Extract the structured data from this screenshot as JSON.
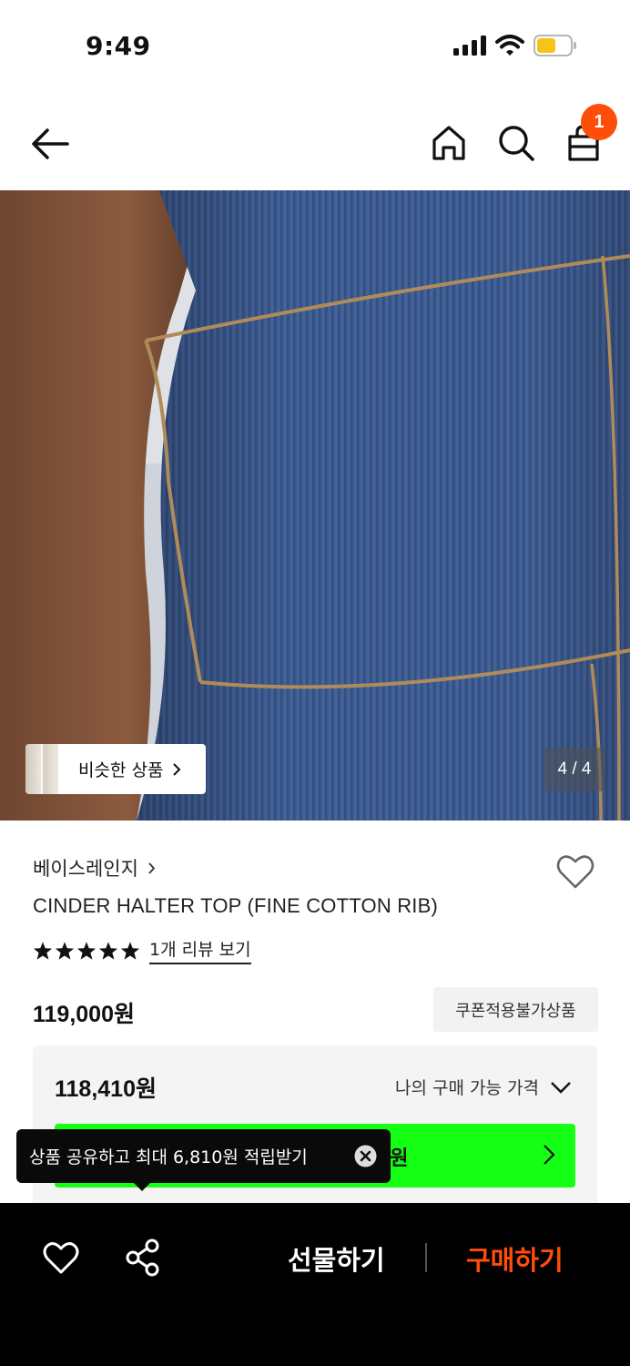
{
  "status_bar": {
    "time": "9:49",
    "icons": [
      "signal-icon",
      "wifi-icon",
      "battery-icon"
    ],
    "battery_color": "#f7c31b"
  },
  "nav": {
    "icons": [
      "back-arrow-icon",
      "home-icon",
      "search-icon",
      "bag-icon"
    ],
    "cart_count": "1",
    "badge_color": "#ff4d0a"
  },
  "gallery": {
    "similar_label": "비슷한 상품",
    "counter": "4 / 4"
  },
  "product": {
    "brand": "베이스레인지",
    "title": "CINDER HALTER TOP (FINE COTTON RIB)",
    "rating_stars": 5,
    "review_link": "1개 리뷰 보기",
    "price": "119,000원",
    "coupon_note": "쿠폰적용불가상품"
  },
  "my_price": {
    "value": "118,410원",
    "toggle_label": "나의 구매 가능 가격",
    "button_text_partial": "0원",
    "button_color": "#14ff14"
  },
  "tooltip": {
    "text": "상품 공유하고 최대 6,810원 적립받기"
  },
  "bottom_bar": {
    "gift_label": "선물하기",
    "buy_label": "구매하기",
    "buy_color": "#ff4d0a"
  }
}
